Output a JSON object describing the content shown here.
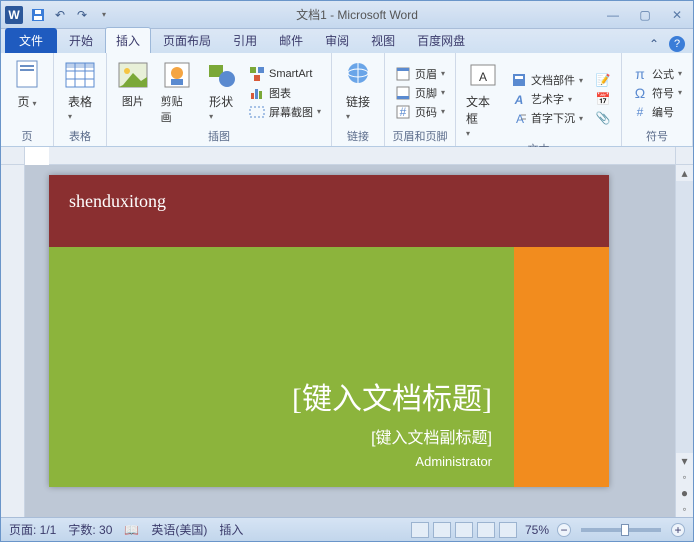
{
  "titlebar": {
    "doc_title": "文档1 - Microsoft Word"
  },
  "tabs": {
    "file": "文件",
    "items": [
      "开始",
      "插入",
      "页面布局",
      "引用",
      "邮件",
      "审阅",
      "视图",
      "百度网盘"
    ],
    "active_index": 1
  },
  "ribbon": {
    "groups": {
      "pages": {
        "label": "页",
        "page_btn": "页"
      },
      "tables": {
        "label": "表格",
        "table_btn": "表格"
      },
      "illustrations": {
        "label": "插图",
        "picture": "图片",
        "clipart": "剪贴画",
        "shapes": "形状",
        "smartart": "SmartArt",
        "chart": "图表",
        "screenshot": "屏幕截图"
      },
      "links": {
        "label": "链接",
        "link_btn": "链接"
      },
      "headerfooter": {
        "label": "页眉和页脚",
        "header": "页眉",
        "footer": "页脚",
        "pagenum": "页码"
      },
      "text": {
        "label": "文本",
        "textbox": "文本框",
        "quickparts": "文档部件",
        "wordart": "艺术字",
        "dropcap": "首字下沉"
      },
      "symbols": {
        "label": "符号",
        "equation": "公式",
        "symbol": "符号",
        "number": "编号"
      }
    }
  },
  "document": {
    "header_text": "shenduxitong",
    "title_placeholder": "[键入文档标题]",
    "subtitle_placeholder": "[键入文档副标题]",
    "author": "Administrator"
  },
  "statusbar": {
    "page": "页面: 1/1",
    "words": "字数: 30",
    "language": "英语(美国)",
    "mode": "插入",
    "zoom": "75%"
  }
}
